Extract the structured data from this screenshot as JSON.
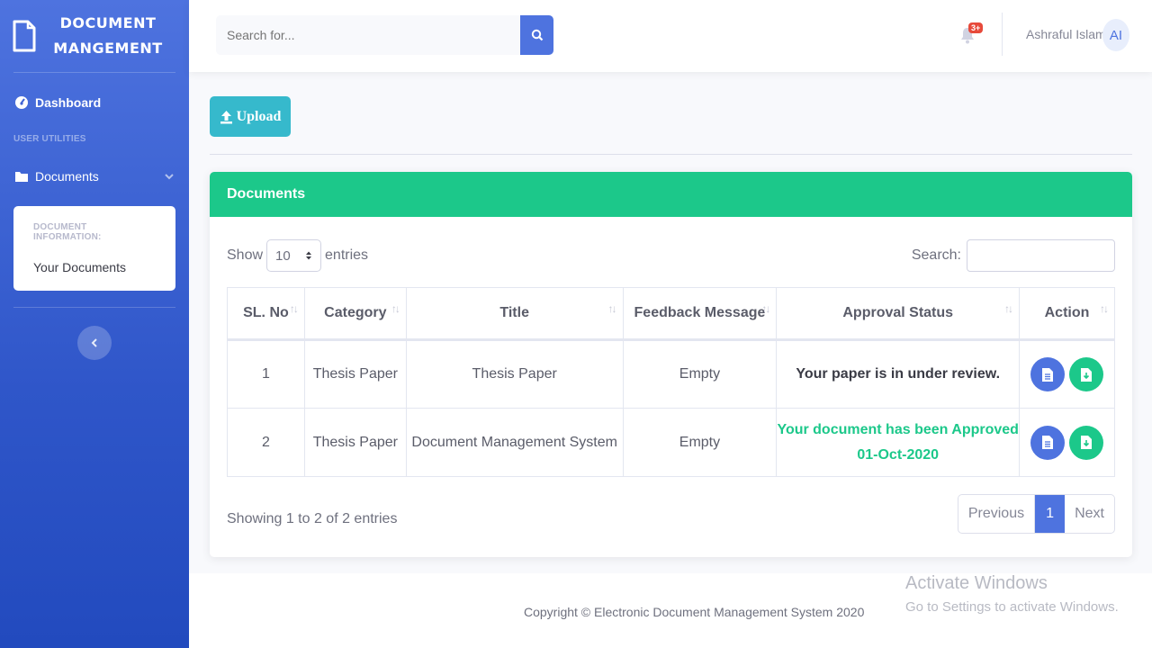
{
  "sidebar": {
    "brand_line1": "DOCUMENT",
    "brand_line2": "MANGEMENT",
    "dashboard_label": "Dashboard",
    "heading": "USER UTILITIES",
    "documents_label": "Documents",
    "collapse_header": "DOCUMENT INFORMATION:",
    "collapse_item": "Your Documents"
  },
  "topbar": {
    "search_placeholder": "Search for...",
    "alerts_badge": "3+",
    "username": "Ashraful Islam",
    "avatar_initials": "AI"
  },
  "upload_label": "Upload",
  "card": {
    "title": "Documents",
    "show_label": "Show",
    "length_value": "10",
    "entries_label": "entries",
    "search_label": "Search:",
    "columns": [
      "SL. No",
      "Category",
      "Title",
      "Feedback Message",
      "Approval Status",
      "Action"
    ],
    "rows": [
      {
        "sl": "1",
        "category": "Thesis Paper",
        "title": "Thesis Paper",
        "feedback": "Empty",
        "status_line1": "Your paper is in under review.",
        "status_line2": ""
      },
      {
        "sl": "2",
        "category": "Thesis Paper",
        "title": "Document Management System",
        "feedback": "Empty",
        "status_line1": "Your document has been Approved",
        "status_line2": "01-Oct-2020"
      }
    ],
    "info": "Showing 1 to 2 of 2 entries",
    "pager": {
      "previous": "Previous",
      "current": "1",
      "next": "Next"
    }
  },
  "footer": {
    "copyright": "Copyright © Electronic Document Management System 2020"
  },
  "watermark": {
    "line1": "Activate Windows",
    "line2": "Go to Settings to activate Windows."
  }
}
